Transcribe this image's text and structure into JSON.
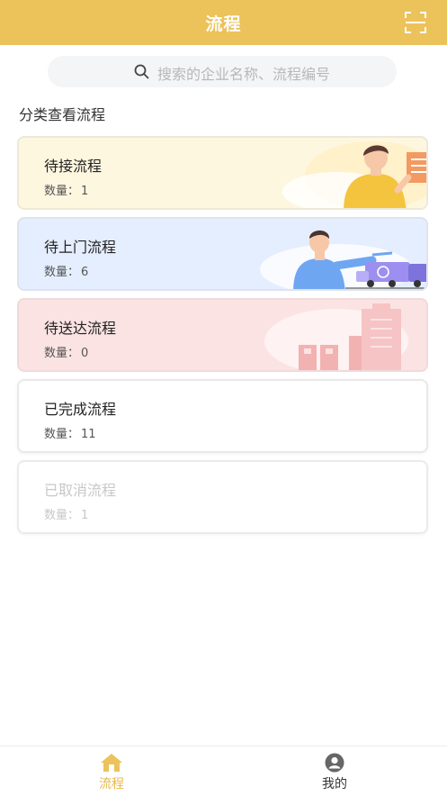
{
  "header": {
    "title": "流程",
    "scan_icon": "scan-icon"
  },
  "search": {
    "placeholder": "搜索的企业名称、流程编号"
  },
  "section": {
    "title": "分类查看流程"
  },
  "cards": [
    {
      "title": "待接流程",
      "count_label": "数量：",
      "count": "1",
      "bg": "#FEF7E0"
    },
    {
      "title": "待上门流程",
      "count_label": "数量：",
      "count": "6",
      "bg": "#E5EEFE"
    },
    {
      "title": "待送达流程",
      "count_label": "数量：",
      "count": "0",
      "bg": "#FCE3E3"
    },
    {
      "title": "已完成流程",
      "count_label": "数量：",
      "count": "11",
      "bg": "#FFFFFF"
    },
    {
      "title": "已取消流程",
      "count_label": "数量：",
      "count": "1",
      "bg": "#FFFFFF"
    }
  ],
  "tabbar": {
    "tabs": [
      {
        "label": "流程",
        "icon": "home-icon",
        "active": true
      },
      {
        "label": "我的",
        "icon": "user-icon",
        "active": false
      }
    ]
  },
  "colors": {
    "accent": "#ECC25A",
    "active_tab": "#E8B84A"
  }
}
